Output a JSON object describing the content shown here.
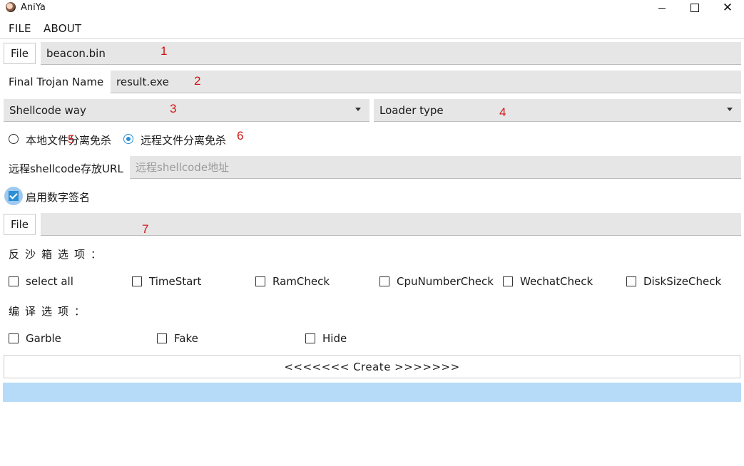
{
  "window": {
    "title": "AniYa",
    "controls": {
      "minimize": "minimize-icon",
      "maximize": "maximize-icon",
      "close": "close-icon"
    }
  },
  "menu": {
    "file": "FILE",
    "about": "ABOUT"
  },
  "beacon": {
    "button": "File",
    "value": "beacon.bin",
    "annotation": "1"
  },
  "trojan": {
    "label": "Final Trojan Name",
    "value": "result.exe",
    "annotation": "2"
  },
  "shellcode_way": {
    "value": "Shellcode way",
    "annotation": "3"
  },
  "loader_type": {
    "value": "Loader type",
    "annotation": "4"
  },
  "separation": {
    "local": {
      "label": "本地文件分离免杀",
      "checked": false,
      "annotation": "5"
    },
    "remote": {
      "label": "远程文件分离免杀",
      "checked": true,
      "annotation": "6"
    }
  },
  "remote_url": {
    "label": "远程shellcode存放URL",
    "placeholder": "远程shellcode地址",
    "value": ""
  },
  "signature": {
    "label": "启用数字签名",
    "checked": true
  },
  "signature_file": {
    "button": "File",
    "value": "",
    "annotation": "7"
  },
  "anti_sandbox": {
    "title": "反沙箱选项：",
    "options": [
      {
        "label": "select all",
        "checked": false
      },
      {
        "label": "TimeStart",
        "checked": false
      },
      {
        "label": "RamCheck",
        "checked": false
      },
      {
        "label": "CpuNumberCheck",
        "checked": false
      },
      {
        "label": "WechatCheck",
        "checked": false
      },
      {
        "label": "DiskSizeCheck",
        "checked": false
      }
    ]
  },
  "compile": {
    "title": "编译选项：",
    "options": [
      {
        "label": "Garble",
        "checked": false
      },
      {
        "label": "Fake",
        "checked": false
      },
      {
        "label": "Hide",
        "checked": false
      }
    ]
  },
  "create_button": "<<<<<<< Create >>>>>>>",
  "progress": {
    "fraction": 1.0
  },
  "colors": {
    "accent": "#2a8fd6",
    "annotation": "#d01515",
    "input_bg": "#e6e6e6",
    "progress": "#b6dbf8"
  }
}
